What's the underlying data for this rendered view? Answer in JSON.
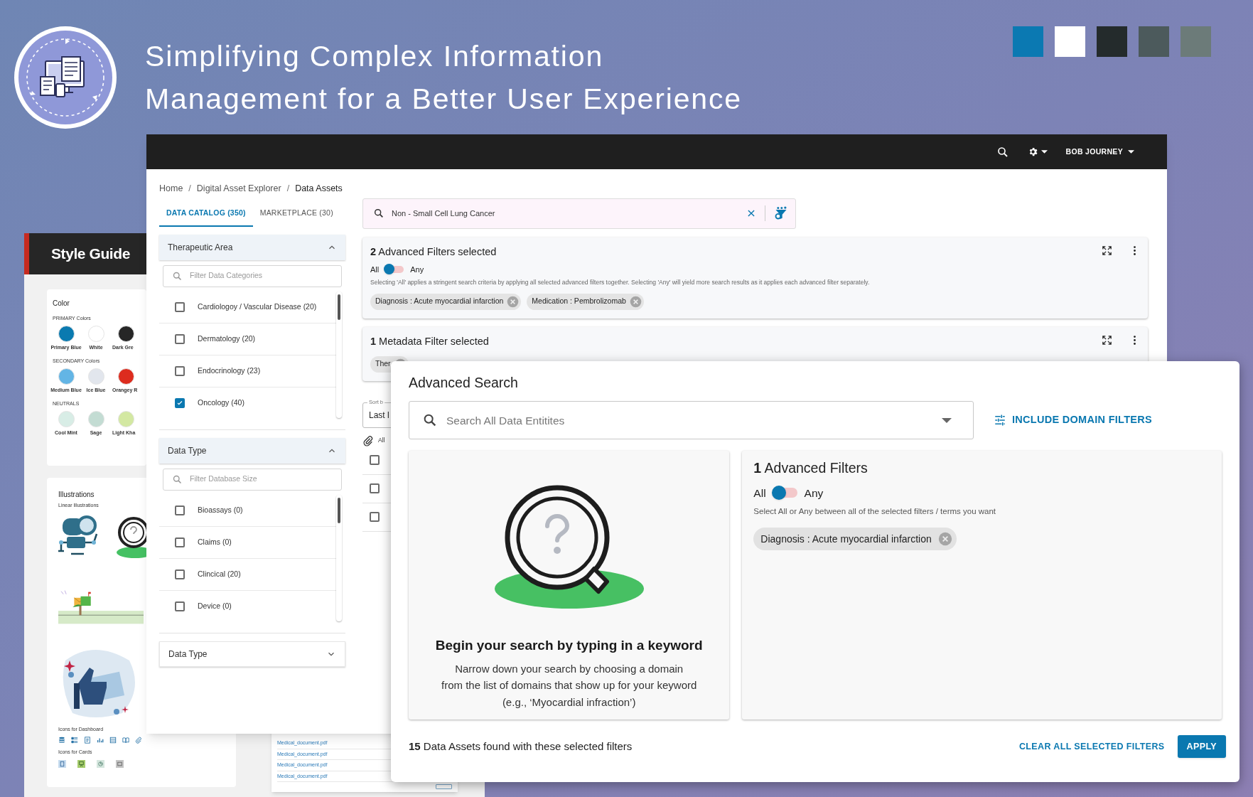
{
  "banner": {
    "title_lines": [
      "Simplifying Complex Information",
      "Management for a Better User Experience"
    ],
    "swatches": [
      {
        "color": "#0b79b2"
      },
      {
        "color": "#ffffff"
      },
      {
        "color": "#242b2c"
      },
      {
        "color": "#4c5a5c"
      },
      {
        "color": "#6c7b79"
      }
    ]
  },
  "style_guide": {
    "title": "Style Guide",
    "color_card": {
      "title": "Color",
      "groups": [
        {
          "label": "PRIMARY Colors",
          "swatches": [
            {
              "name": "Primary Blue",
              "color": "#0a7ab0"
            },
            {
              "name": "White",
              "color": "#ffffff"
            },
            {
              "name": "Dark Gre",
              "color": "#262626"
            }
          ]
        },
        {
          "label": "SECONDARY Colors",
          "swatches": [
            {
              "name": "Medium Blue",
              "color": "#63b5e5"
            },
            {
              "name": "Ice Blue",
              "color": "#e2e6ed"
            },
            {
              "name": "Orangey R",
              "color": "#dd2c1e"
            }
          ]
        },
        {
          "label": "NEUTRALS",
          "swatches": [
            {
              "name": "Cool Mint",
              "color": "#d8ede6"
            },
            {
              "name": "Sage",
              "color": "#c3dcd3"
            },
            {
              "name": "Light Kha",
              "color": "#d3e8a2"
            }
          ]
        }
      ]
    },
    "illustrations": {
      "title": "Illustrations",
      "subtitle": "Linear Illustrations",
      "dashboard_icons_label": "Icons for Dashboard",
      "card_icons_label": "Icons for Cards"
    },
    "document_links": [
      "Medical_document.pdf",
      "Medical_document.pdf",
      "Medical_document.pdf",
      "Medical_document.pdf"
    ]
  },
  "app": {
    "user": "BOB JOURNEY",
    "breadcrumb": [
      "Home",
      "Digital Asset Explorer",
      "Data Assets"
    ],
    "breadcrumb_separator": "/",
    "tabs": [
      {
        "label": "DATA CATALOG (350)",
        "selected": true
      },
      {
        "label": "MARKETPLACE (30)",
        "selected": false
      }
    ],
    "filter_sections": [
      {
        "title": "Therapeutic Area",
        "expanded": true,
        "placeholder": "Filter Data Categories",
        "options": [
          {
            "label": "Cardiologoy / Vascular Disease (20)",
            "checked": false
          },
          {
            "label": "Dermatology (20)",
            "checked": false
          },
          {
            "label": "Endocrinology (23)",
            "checked": false
          },
          {
            "label": "Oncology (40)",
            "checked": true
          }
        ]
      },
      {
        "title": "Data Type",
        "expanded": true,
        "placeholder": "Filter Database Size",
        "options": [
          {
            "label": "Bioassays (0)",
            "checked": false
          },
          {
            "label": "Claims (0)",
            "checked": false
          },
          {
            "label": "Clincical (20)",
            "checked": false
          },
          {
            "label": "Device (0)",
            "checked": false
          }
        ]
      },
      {
        "title": "Data Type",
        "expanded": false
      }
    ],
    "search": {
      "value": "Non - Small Cell Lung Cancer"
    },
    "advanced_card": {
      "title": "**2** Advanced Filters selected",
      "all_label": "All",
      "any_label": "Any",
      "mode_any": false,
      "note": "Selecting 'All' applies a stringent search criteria by applying all selected advanced filters together. Selecting 'Any' will yield more search results as it applies each advanced filter separately.",
      "chips": [
        "Diagnosis : Acute myocardial infarction",
        "Medication : Pembrolizomab"
      ]
    },
    "metadata_card": {
      "title": "**1** Metadata Filter selected",
      "chips": [
        "Ther"
      ]
    },
    "sort": {
      "label": "Sort b",
      "value": "Last l"
    },
    "attach_label": "All",
    "rows": [
      {
        "checked": false
      },
      {
        "checked": false
      },
      {
        "checked": false
      }
    ]
  },
  "advanced_search": {
    "title": "Advanced Search",
    "placeholder": "Search All Data Entitites",
    "domain_button": "INCLUDE DOMAIN FILTERS",
    "empty": {
      "heading": "Begin your search by typing in a keyword",
      "text": "Narrow down your search by choosing a domain\nfrom the list of domains that show up for your keyword\n(e.g., ‘Myocardial infraction’)"
    },
    "filters": {
      "title": "**1** Advanced Filters",
      "all_label": "All",
      "any_label": "Any",
      "mode_any": false,
      "note": "Select All or Any between all of the selected filters / terms you want",
      "chips": [
        "Diagnosis : Acute myocardial infarction"
      ]
    },
    "result": "**15** Data Assets found with these selected filters",
    "clear_button": "CLEAR ALL SELECTED FILTERS",
    "apply_button": "APPLY"
  }
}
